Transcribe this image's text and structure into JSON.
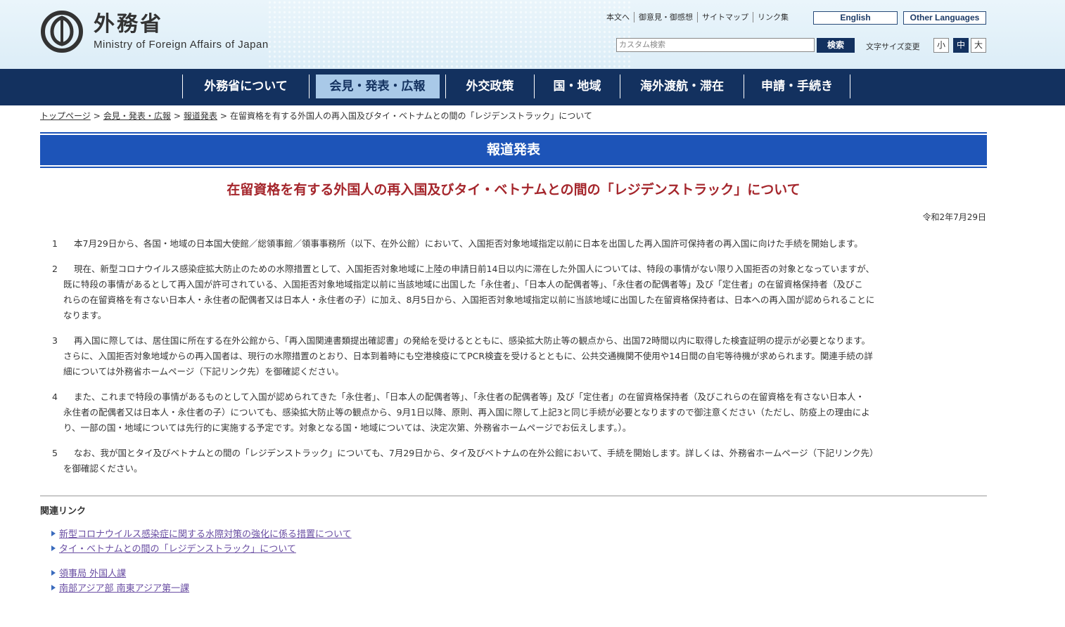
{
  "header": {
    "logo_jp": "外務省",
    "logo_en": "Ministry of Foreign Affairs of Japan",
    "util_links": [
      "本文へ",
      "御意見・御感想",
      "サイトマップ",
      "リンク集"
    ],
    "lang_english": "English",
    "lang_other": "Other Languages",
    "search_placeholder": "カスタム検索",
    "search_button": "検索",
    "fontsize_label": "文字サイズ変更",
    "fontsize_small": "小",
    "fontsize_medium": "中",
    "fontsize_large": "大"
  },
  "nav": {
    "items": [
      {
        "label": "外務省について"
      },
      {
        "label": "会見・発表・広報",
        "active": true
      },
      {
        "label": "外交政策"
      },
      {
        "label": "国・地域"
      },
      {
        "label": "海外渡航・滞在"
      },
      {
        "label": "申請・手続き"
      }
    ]
  },
  "breadcrumb": {
    "items": [
      "トップページ",
      "会見・発表・広報",
      "報道発表"
    ],
    "current": "在留資格を有する外国人の再入国及びタイ・ベトナムとの間の「レジデンストラック」について"
  },
  "banner": "報道発表",
  "title": "在留資格を有する外国人の再入国及びタイ・ベトナムとの間の「レジデンストラック」について",
  "date": "令和2年7月29日",
  "paragraphs": [
    {
      "num": "1",
      "lines": [
        "本7月29日から、各国・地域の日本国大使館／総領事館／領事事務所（以下、在外公館）において、入国拒否対象地域指定以前に日本を出国した再入国許可保持者の再入国に向けた手続を開始します。"
      ]
    },
    {
      "num": "2",
      "lines": [
        "現在、新型コロナウイルス感染症拡大防止のための水際措置として、入国拒否対象地域に上陸の申請日前14日以内に滞在した外国人については、特段の事情がない限り入国拒否の対象となっていますが、",
        "既に特段の事情があるとして再入国が許可されている、入国拒否対象地域指定以前に当該地域に出国した「永住者」、「日本人の配偶者等」、「永住者の配偶者等」及び「定住者」の在留資格保持者（及びこ",
        "れらの在留資格を有さない日本人・永住者の配偶者又は日本人・永住者の子）に加え、8月5日から、入国拒否対象地域指定以前に当該地域に出国した在留資格保持者は、日本への再入国が認められることに",
        "なります。"
      ]
    },
    {
      "num": "3",
      "lines": [
        "再入国に際しては、居住国に所在する在外公館から、「再入国関連書類提出確認書」の発給を受けるとともに、感染拡大防止等の観点から、出国72時間以内に取得した検査証明の提示が必要となります。",
        "さらに、入国拒否対象地域からの再入国者は、現行の水際措置のとおり、日本到着時にも空港検疫にてPCR検査を受けるとともに、公共交通機関不使用や14日間の自宅等待機が求められます。関連手続の詳",
        "細については外務省ホームページ（下記リンク先）を御確認ください。"
      ]
    },
    {
      "num": "4",
      "lines": [
        "また、これまで特段の事情があるものとして入国が認められてきた「永住者」、「日本人の配偶者等」、「永住者の配偶者等」及び「定住者」の在留資格保持者（及びこれらの在留資格を有さない日本人・",
        "永住者の配偶者又は日本人・永住者の子）についても、感染拡大防止等の観点から、9月1日以降、原則、再入国に際して上記3と同じ手続が必要となりますので御注意ください（ただし、防疫上の理由によ",
        "り、一部の国・地域については先行的に実施する予定です。対象となる国・地域については、決定次第、外務省ホームページでお伝えします。）。"
      ]
    },
    {
      "num": "5",
      "lines": [
        "なお、我が国とタイ及びベトナムとの間の「レジデンストラック」についても、7月29日から、タイ及びベトナムの在外公館において、手続を開始します。詳しくは、外務省ホームページ（下記リンク先）",
        "を御確認ください。"
      ]
    }
  ],
  "related": {
    "title": "関連リンク",
    "group1": [
      "新型コロナウイルス感染症に関する水際対策の強化に係る措置について",
      "タイ・ベトナムとの間の「レジデンストラック」について"
    ],
    "group2": [
      "領事局 外国人課",
      "南部アジア部 南東アジア第一課"
    ]
  },
  "colors": {
    "nav_bg": "#13315f",
    "nav_active": "#a9c9e8",
    "banner": "#1d54b8",
    "title": "#a5262c",
    "link": "#6a4ea3"
  }
}
